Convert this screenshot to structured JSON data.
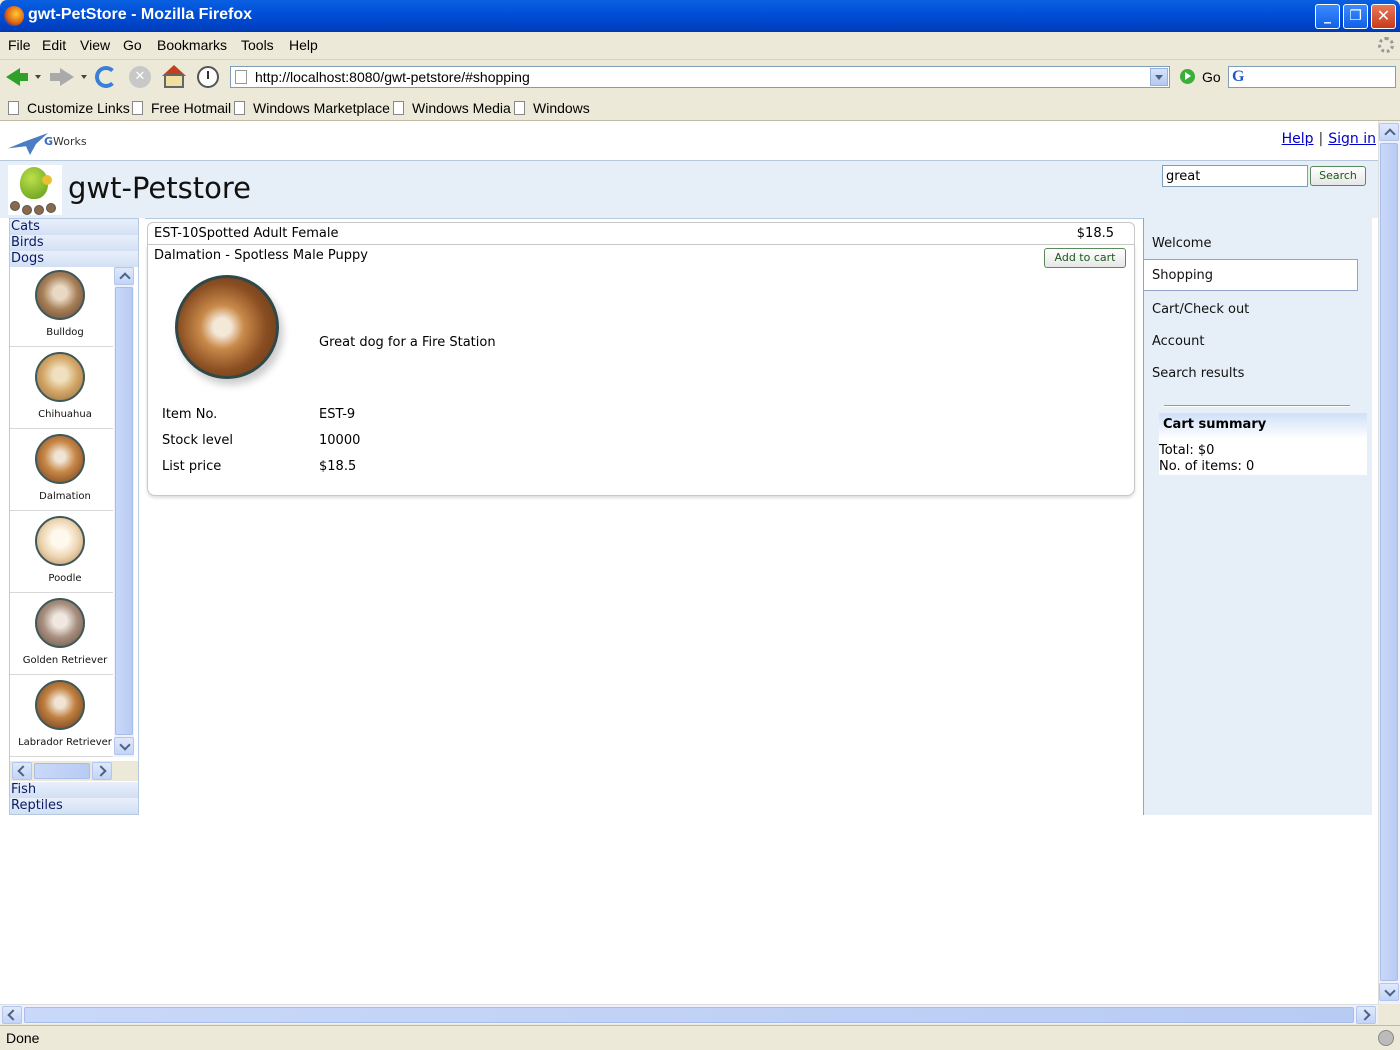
{
  "window": {
    "title": "gwt-PetStore - Mozilla Firefox"
  },
  "menubar": [
    "File",
    "Edit",
    "View",
    "Go",
    "Bookmarks",
    "Tools",
    "Help"
  ],
  "toolbar": {
    "url": "http://localhost:8080/gwt-petstore/#shopping",
    "go_label": "Go"
  },
  "bookmarks": [
    "Customize Links",
    "Free Hotmail",
    "Windows Marketplace",
    "Windows Media",
    "Windows"
  ],
  "status": "Done",
  "page": {
    "brand": {
      "g": "G",
      "rest": "Works"
    },
    "toplinks": {
      "help": "Help",
      "separator": "|",
      "signin": "Sign in"
    },
    "app_title": "gwt-Petstore",
    "search": {
      "value": "great",
      "button": "Search"
    },
    "categories_top": [
      "Cats",
      "Birds",
      "Dogs"
    ],
    "categories_bottom": [
      "Fish",
      "Reptiles"
    ],
    "breeds": [
      "Bulldog",
      "Chihuahua",
      "Dalmation",
      "Poodle",
      "Golden Retriever",
      "Labrador Retriever"
    ],
    "item_row": {
      "name": "EST-10Spotted Adult Female",
      "price": "$18.5"
    },
    "detail": {
      "name": "Dalmation - Spotless Male Puppy",
      "add_to_cart": "Add to cart",
      "description": "Great dog for a Fire Station",
      "fields": [
        {
          "label": "Item No.",
          "value": "EST-9"
        },
        {
          "label": "Stock level",
          "value": "10000"
        },
        {
          "label": "List price",
          "value": "$18.5"
        }
      ]
    },
    "nav": [
      "Welcome",
      "Shopping",
      "Cart/Check out",
      "Account",
      "Search results"
    ],
    "active_nav": "Shopping",
    "cart": {
      "title": "Cart summary",
      "total": "Total: $0",
      "items": "No. of items: 0"
    }
  }
}
